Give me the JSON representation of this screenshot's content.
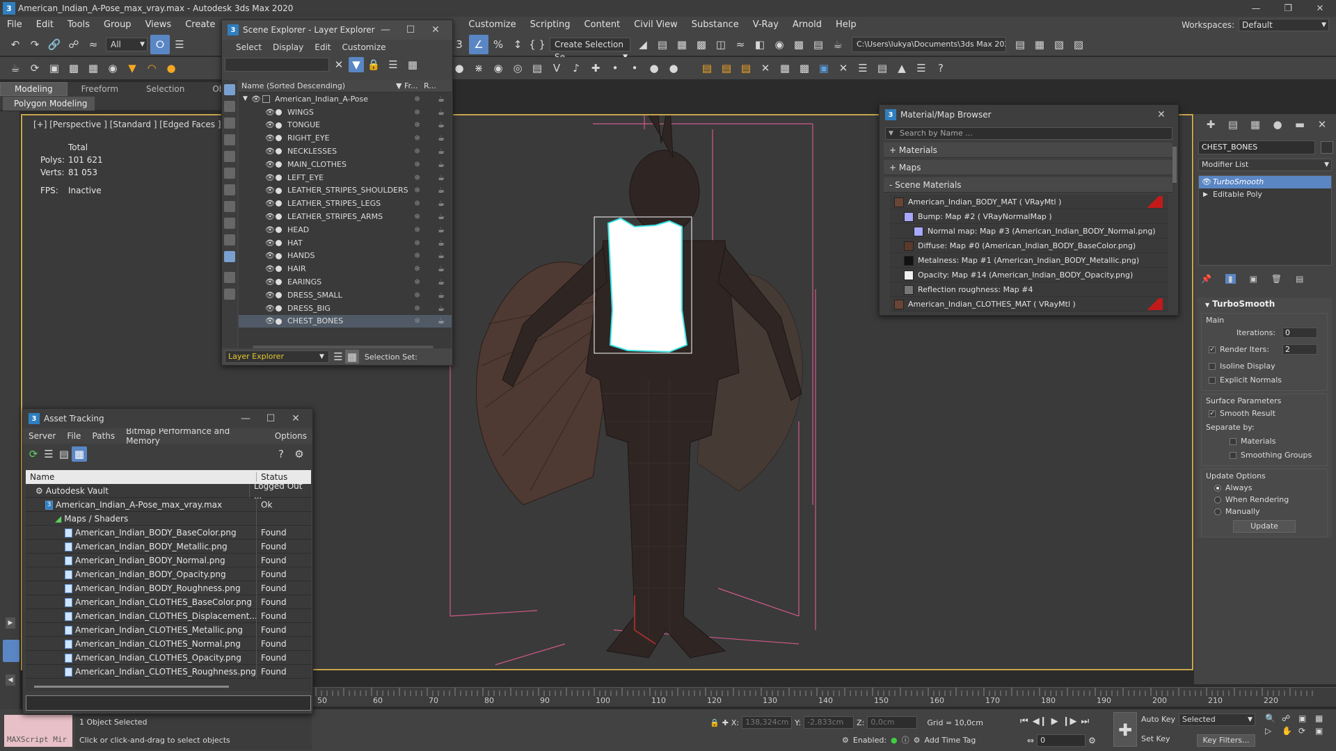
{
  "title_bar": {
    "app_icon": "3",
    "title": "American_Indian_A-Pose_max_vray.max - Autodesk 3ds Max 2020"
  },
  "menu": {
    "items": [
      "File",
      "Edit",
      "Tools",
      "Group",
      "Views",
      "Create",
      "Customize",
      "Scripting",
      "Content",
      "Civil View",
      "Substance",
      "V-Ray",
      "Arnold",
      "Help"
    ],
    "workspace_label": "Workspaces:",
    "workspace_value": "Default"
  },
  "toolbar": {
    "filter_value": "All",
    "selection_set_placeholder": "Create Selection Se",
    "project_path": "C:\\Users\\lukya\\Documents\\3ds Max 2022"
  },
  "ribbon": {
    "tabs": [
      "Modeling",
      "Freeform",
      "Selection",
      "Ob"
    ],
    "sub": "Polygon Modeling"
  },
  "viewport": {
    "label": "[+] [Perspective ] [Standard ] [Edged Faces ]",
    "stats": {
      "total": "Total",
      "polys_label": "Polys:",
      "polys": "101 621",
      "verts_label": "Verts:",
      "verts": "81 053",
      "fps_label": "FPS:",
      "fps": "Inactive"
    }
  },
  "scene_explorer": {
    "title": "Scene Explorer - Layer Explorer",
    "menu": [
      "Select",
      "Display",
      "Edit",
      "Customize"
    ],
    "col_name": "Name (Sorted Descending)",
    "col_fr": "▼ Fr...",
    "col_r": "R...",
    "root": "American_Indian_A-Pose",
    "layers": [
      "WINGS",
      "TONGUE",
      "RIGHT_EYE",
      "NECKLESSES",
      "MAIN_CLOTHES",
      "LEFT_EYE",
      "LEATHER_STRIPES_SHOULDERS",
      "LEATHER_STRIPES_LEGS",
      "LEATHER_STRIPES_ARMS",
      "HEAD",
      "HAT",
      "HANDS",
      "HAIR",
      "EARINGS",
      "DRESS_SMALL",
      "DRESS_BIG",
      "CHEST_BONES"
    ],
    "selected_layer": "CHEST_BONES",
    "bottom_dropdown": "Layer Explorer",
    "selection_set_label": "Selection Set:"
  },
  "material_browser": {
    "title": "Material/Map Browser",
    "search_placeholder": "Search by Name ...",
    "sections": [
      "+ Materials",
      "+ Maps",
      "- Scene Materials"
    ],
    "entries": [
      {
        "text": "American_Indian_BODY_MAT  ( VRayMtl )",
        "indent": 0,
        "swatch": "#6a4535",
        "red": true
      },
      {
        "text": "Bump: Map #2  ( VRayNormalMap )",
        "indent": 1,
        "swatch": "#a8a8ff",
        "red": false
      },
      {
        "text": "Normal map: Map #3 (American_Indian_BODY_Normal.png)",
        "indent": 2,
        "swatch": "#a8a8ff",
        "red": false
      },
      {
        "text": "Diffuse: Map #0 (American_Indian_BODY_BaseColor.png)",
        "indent": 1,
        "swatch": "#5a3a2a",
        "red": false
      },
      {
        "text": "Metalness: Map #1 (American_Indian_BODY_Metallic.png)",
        "indent": 1,
        "swatch": "#111111",
        "red": false
      },
      {
        "text": "Opacity: Map #14 (American_Indian_BODY_Opacity.png)",
        "indent": 1,
        "swatch": "#f0f0f0",
        "red": false
      },
      {
        "text": "Reflection roughness: Map #4 (American_Indian_BODY_Roughness.p...",
        "indent": 1,
        "swatch": "#777777",
        "red": false
      },
      {
        "text": "American_Indian_CLOTHES_MAT  ( VRayMtl )",
        "indent": 0,
        "swatch": "#6a4535",
        "red": true
      }
    ]
  },
  "asset_tracking": {
    "title": "Asset Tracking",
    "menu": [
      "Server",
      "File",
      "Paths",
      "Bitmap Performance and Memory",
      "Options"
    ],
    "col_name": "Name",
    "col_status": "Status",
    "rows": [
      {
        "name": "Autodesk Vault",
        "status": "Logged Out ...",
        "indent": 1,
        "type": "vault"
      },
      {
        "name": "American_Indian_A-Pose_max_vray.max",
        "status": "Ok",
        "indent": 2,
        "type": "max"
      },
      {
        "name": "Maps / Shaders",
        "status": "",
        "indent": 3,
        "type": "folder"
      },
      {
        "name": "American_Indian_BODY_BaseColor.png",
        "status": "Found",
        "indent": 4,
        "type": "file"
      },
      {
        "name": "American_Indian_BODY_Metallic.png",
        "status": "Found",
        "indent": 4,
        "type": "file"
      },
      {
        "name": "American_Indian_BODY_Normal.png",
        "status": "Found",
        "indent": 4,
        "type": "file"
      },
      {
        "name": "American_Indian_BODY_Opacity.png",
        "status": "Found",
        "indent": 4,
        "type": "file"
      },
      {
        "name": "American_Indian_BODY_Roughness.png",
        "status": "Found",
        "indent": 4,
        "type": "file"
      },
      {
        "name": "American_Indian_CLOTHES_BaseColor.png",
        "status": "Found",
        "indent": 4,
        "type": "file"
      },
      {
        "name": "American_Indian_CLOTHES_Displacement....",
        "status": "Found",
        "indent": 4,
        "type": "file"
      },
      {
        "name": "American_Indian_CLOTHES_Metallic.png",
        "status": "Found",
        "indent": 4,
        "type": "file"
      },
      {
        "name": "American_Indian_CLOTHES_Normal.png",
        "status": "Found",
        "indent": 4,
        "type": "file"
      },
      {
        "name": "American_Indian_CLOTHES_Opacity.png",
        "status": "Found",
        "indent": 4,
        "type": "file"
      },
      {
        "name": "American_Indian_CLOTHES_Roughness.png",
        "status": "Found",
        "indent": 4,
        "type": "file"
      }
    ]
  },
  "command_panel": {
    "object_name": "CHEST_BONES",
    "modifier_list": "Modifier List",
    "stack": [
      "TurboSmooth",
      "Editable Poly"
    ],
    "turbosmooth": {
      "title": "TurboSmooth",
      "main": "Main",
      "iterations_label": "Iterations:",
      "iterations": "0",
      "render_iters_label": "Render Iters:",
      "render_iters": "2",
      "isoline": "Isoline Display",
      "explicit_normals": "Explicit Normals",
      "surface_params": "Surface Parameters",
      "smooth_result": "Smooth Result",
      "separate_by": "Separate by:",
      "materials": "Materials",
      "smoothing_groups": "Smoothing Groups",
      "update_options": "Update Options",
      "always": "Always",
      "when_rendering": "When Rendering",
      "manually": "Manually",
      "update_btn": "Update"
    }
  },
  "timeline": {
    "ticks": [
      "50",
      "60",
      "70",
      "80",
      "90",
      "100",
      "110",
      "120",
      "130",
      "140",
      "150",
      "160",
      "170",
      "180",
      "190",
      "200",
      "210",
      "220"
    ]
  },
  "status_bar": {
    "maxscript": "MAXScript Mir",
    "selected": "1 Object Selected",
    "prompt": "Click or click-and-drag to select objects",
    "x_label": "X:",
    "x": "138,324cm",
    "y_label": "Y:",
    "y": "-2,833cm",
    "z_label": "Z:",
    "z": "0,0cm",
    "grid": "Grid = 10,0cm",
    "enabled": "Enabled:",
    "add_time_tag": "Add Time Tag",
    "auto_key": "Auto Key",
    "set_key": "Set Key",
    "selected_dd": "Selected",
    "key_filters": "Key Filters...",
    "frame": "0"
  }
}
